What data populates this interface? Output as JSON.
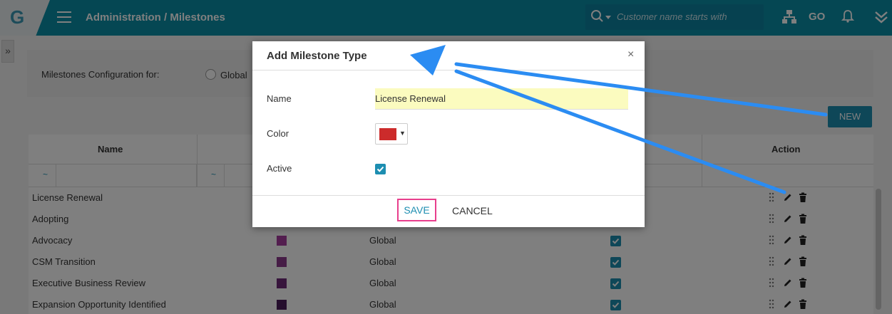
{
  "app": {
    "logo": "G",
    "breadcrumb": "Administration / Milestones"
  },
  "search": {
    "placeholder": "Customer name starts with"
  },
  "topbar_icons": [
    "search-icon",
    "hierarchy-icon",
    "go-icon",
    "bell-icon",
    "chevron-double-down-icon"
  ],
  "topbar_go_label": "GO",
  "side_expander": "»",
  "config": {
    "label": "Milestones Configuration for:",
    "radio_label": "Global"
  },
  "toolbar": {
    "new_label": "NEW"
  },
  "grid": {
    "headers": {
      "name": "Name",
      "action": "Action"
    },
    "filter_symbol": "~",
    "rows": [
      {
        "name": "License Renewal",
        "color": "",
        "scope": "",
        "active": false
      },
      {
        "name": "Adopting",
        "color": "",
        "scope": "",
        "active": false
      },
      {
        "name": "Advocacy",
        "color": "#a63c9f",
        "scope": "Global",
        "active": true
      },
      {
        "name": "CSM Transition",
        "color": "#8c3a8c",
        "scope": "Global",
        "active": true
      },
      {
        "name": "Executive Business Review",
        "color": "#6e2a78",
        "scope": "Global",
        "active": true
      },
      {
        "name": "Expansion Opportunity Identified",
        "color": "#4a1d5a",
        "scope": "Global",
        "active": true
      }
    ]
  },
  "modal": {
    "title": "Add Milestone Type",
    "close": "×",
    "name_label": "Name",
    "name_value": "License Renewal",
    "color_label": "Color",
    "color_value": "#cc2b2b",
    "color_caret": "▼",
    "active_label": "Active",
    "active": true,
    "save_label": "SAVE",
    "cancel_label": "CANCEL"
  },
  "colors": {
    "topbar": "#0a8fa6",
    "accent": "#1d8eb1",
    "save_highlight": "#e83e8c",
    "annotation_arrow": "#2b8cf2"
  }
}
